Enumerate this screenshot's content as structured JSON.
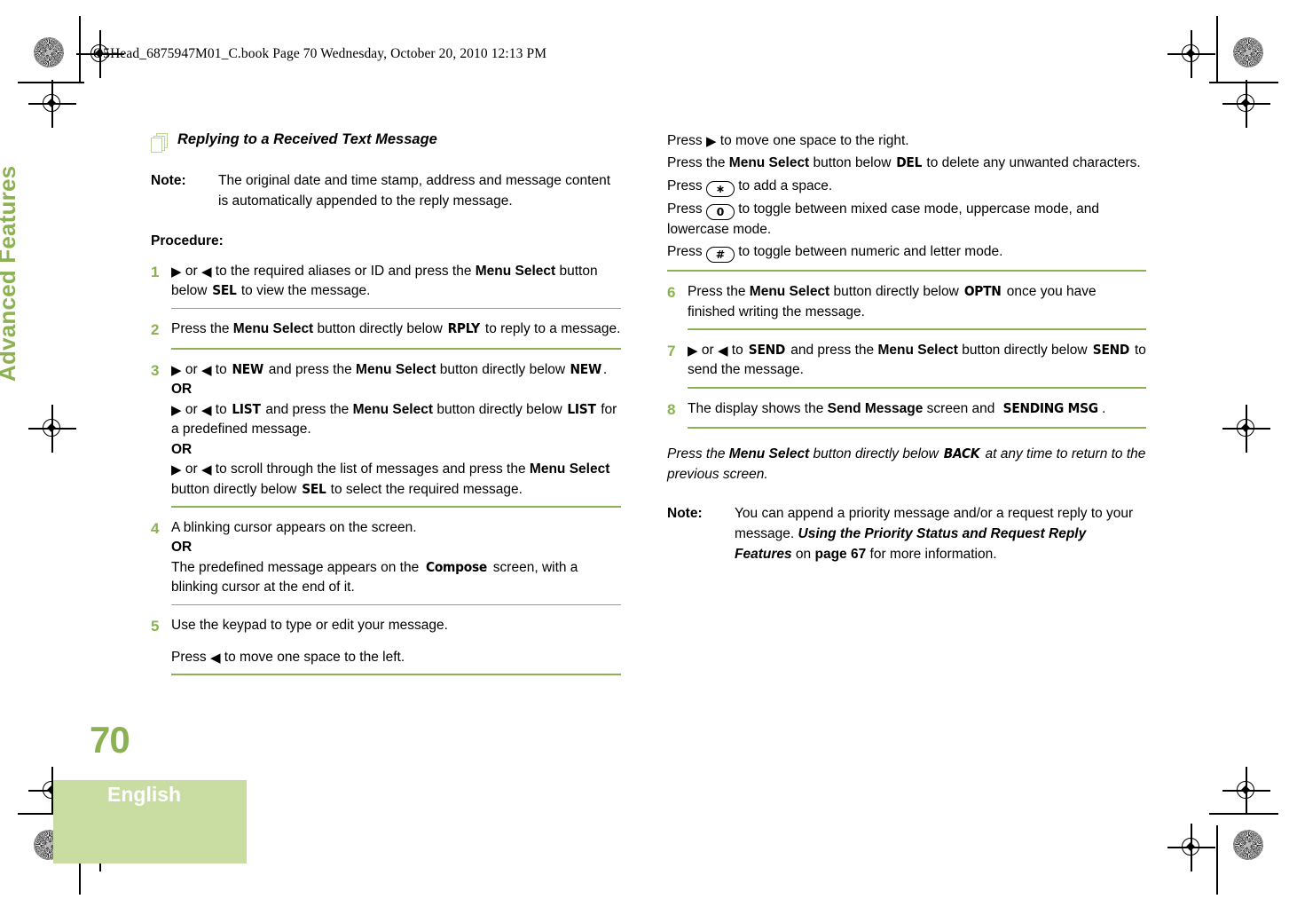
{
  "header": {
    "slug": "O5Head_6875947M01_C.book  Page 70  Wednesday, October 20, 2010  12:13 PM"
  },
  "sidebar": {
    "chapter": "Advanced Features",
    "page_number": "70",
    "language": "English",
    "accent_green": "#8cb152",
    "block_green": "#c9dda3"
  },
  "left_column": {
    "section_heading": "Replying to a Received Text Message",
    "note_label": "Note:",
    "note_text": "The original date and time stamp, address and message content is automatically appended to the reply message.",
    "procedure_label": "Procedure:",
    "steps": [
      {
        "num": "1",
        "parts": [
          {
            "t": "arrow-right"
          },
          {
            "t": "text",
            "v": " or "
          },
          {
            "t": "arrow-left"
          },
          {
            "t": "text",
            "v": " to the required aliases or ID and press the "
          },
          {
            "t": "bold",
            "v": "Menu Select"
          },
          {
            "t": "text",
            "v": " button below "
          },
          {
            "t": "lcd",
            "v": "SEL"
          },
          {
            "t": "text",
            "v": " to view the message."
          }
        ]
      },
      {
        "num": "2",
        "parts": [
          {
            "t": "text",
            "v": "Press the "
          },
          {
            "t": "bold",
            "v": "Menu Select"
          },
          {
            "t": "text",
            "v": " button directly below "
          },
          {
            "t": "lcd",
            "v": "RPLY"
          },
          {
            "t": "text",
            "v": " to reply to a message."
          }
        ]
      },
      {
        "num": "3",
        "parts": [
          {
            "t": "arrow-right"
          },
          {
            "t": "text",
            "v": " or "
          },
          {
            "t": "arrow-left"
          },
          {
            "t": "text",
            "v": " to "
          },
          {
            "t": "lcd",
            "v": "NEW"
          },
          {
            "t": "text",
            "v": " and press the "
          },
          {
            "t": "bold",
            "v": "Menu Select"
          },
          {
            "t": "text",
            "v": " button directly below "
          },
          {
            "t": "lcd",
            "v": "NEW"
          },
          {
            "t": "text",
            "v": "."
          },
          {
            "t": "br"
          },
          {
            "t": "bold",
            "v": "OR"
          },
          {
            "t": "br"
          },
          {
            "t": "arrow-right"
          },
          {
            "t": "text",
            "v": " or "
          },
          {
            "t": "arrow-left"
          },
          {
            "t": "text",
            "v": " to "
          },
          {
            "t": "lcd",
            "v": "LIST"
          },
          {
            "t": "text",
            "v": " and press the "
          },
          {
            "t": "bold",
            "v": "Menu Select"
          },
          {
            "t": "text",
            "v": " button directly below "
          },
          {
            "t": "lcd",
            "v": "LIST"
          },
          {
            "t": "text",
            "v": " for a predefined message."
          },
          {
            "t": "br"
          },
          {
            "t": "bold",
            "v": "OR"
          },
          {
            "t": "br"
          },
          {
            "t": "arrow-right"
          },
          {
            "t": "text",
            "v": " or "
          },
          {
            "t": "arrow-left"
          },
          {
            "t": "text",
            "v": " to scroll through the list of messages and press the "
          },
          {
            "t": "bold",
            "v": "Menu Select"
          },
          {
            "t": "text",
            "v": " button directly below "
          },
          {
            "t": "lcd",
            "v": "SEL"
          },
          {
            "t": "text",
            "v": " to select the required message."
          }
        ]
      },
      {
        "num": "4",
        "parts": [
          {
            "t": "text",
            "v": "A blinking cursor appears on the screen."
          },
          {
            "t": "br"
          },
          {
            "t": "bold",
            "v": "OR"
          },
          {
            "t": "br"
          },
          {
            "t": "text",
            "v": "The predefined message appears on the "
          },
          {
            "t": "lcd",
            "v": "Compose"
          },
          {
            "t": "text",
            "v": " screen, with a blinking cursor at the end of it."
          }
        ]
      },
      {
        "num": "5",
        "parts": [
          {
            "t": "text",
            "v": "Use the keypad to type or edit your message."
          },
          {
            "t": "para"
          },
          {
            "t": "text",
            "v": "Press "
          },
          {
            "t": "arrow-left"
          },
          {
            "t": "text",
            "v": " to move one space to the left."
          }
        ]
      }
    ]
  },
  "right_column": {
    "continued_lines": [
      [
        {
          "t": "text",
          "v": "Press "
        },
        {
          "t": "arrow-right"
        },
        {
          "t": "text",
          "v": " to move one space to the right."
        }
      ],
      [
        {
          "t": "text",
          "v": "Press the "
        },
        {
          "t": "bold",
          "v": "Menu Select"
        },
        {
          "t": "text",
          "v": " button below "
        },
        {
          "t": "lcd",
          "v": "DEL"
        },
        {
          "t": "text",
          "v": " to delete any unwanted characters."
        }
      ],
      [
        {
          "t": "text",
          "v": "Press "
        },
        {
          "t": "key",
          "v": "∗"
        },
        {
          "t": "text",
          "v": " to add a space."
        }
      ],
      [
        {
          "t": "text",
          "v": "Press "
        },
        {
          "t": "key",
          "v": "0"
        },
        {
          "t": "text",
          "v": " to toggle between mixed case mode, uppercase mode, and lowercase mode."
        }
      ],
      [
        {
          "t": "text",
          "v": "Press "
        },
        {
          "t": "key",
          "v": "#"
        },
        {
          "t": "text",
          "v": " to toggle between numeric and letter mode."
        }
      ]
    ],
    "steps": [
      {
        "num": "6",
        "parts": [
          {
            "t": "text",
            "v": "Press the "
          },
          {
            "t": "bold",
            "v": "Menu Select"
          },
          {
            "t": "text",
            "v": " button directly below "
          },
          {
            "t": "lcd",
            "v": "OPTN"
          },
          {
            "t": "text",
            "v": " once you have finished writing the message."
          }
        ]
      },
      {
        "num": "7",
        "parts": [
          {
            "t": "arrow-right"
          },
          {
            "t": "text",
            "v": " or "
          },
          {
            "t": "arrow-left"
          },
          {
            "t": "text",
            "v": " to "
          },
          {
            "t": "lcd",
            "v": "SEND"
          },
          {
            "t": "text",
            "v": " and press the "
          },
          {
            "t": "bold",
            "v": "Menu Select"
          },
          {
            "t": "text",
            "v": " button directly below "
          },
          {
            "t": "lcd",
            "v": "SEND"
          },
          {
            "t": "text",
            "v": " to send the message."
          }
        ]
      },
      {
        "num": "8",
        "parts": [
          {
            "t": "text",
            "v": "The display shows the "
          },
          {
            "t": "bold",
            "v": "Send Message"
          },
          {
            "t": "text",
            "v": " screen and "
          },
          {
            "t": "lcd",
            "v": "SENDING MSG"
          },
          {
            "t": "text",
            "v": "."
          }
        ]
      }
    ],
    "back_note": [
      {
        "t": "text",
        "v": "Press the "
      },
      {
        "t": "bold",
        "v": "Menu Select"
      },
      {
        "t": "text",
        "v": " button directly below "
      },
      {
        "t": "lcd-it",
        "v": "BACK"
      },
      {
        "t": "text",
        "v": " at any time to return to the previous screen."
      }
    ],
    "note_label": "Note:",
    "note_parts": [
      {
        "t": "text",
        "v": "You can append a priority message and/or a request reply to your message. "
      },
      {
        "t": "bolditalic",
        "v": "Using the Priority Status and Request Reply Features"
      },
      {
        "t": "text",
        "v": " on "
      },
      {
        "t": "bold",
        "v": "page 67"
      },
      {
        "t": "text",
        "v": " for more information."
      }
    ]
  },
  "icons": {
    "section": "stacked-pages-icon",
    "arrow_right": "▶",
    "arrow_left": "◀"
  }
}
